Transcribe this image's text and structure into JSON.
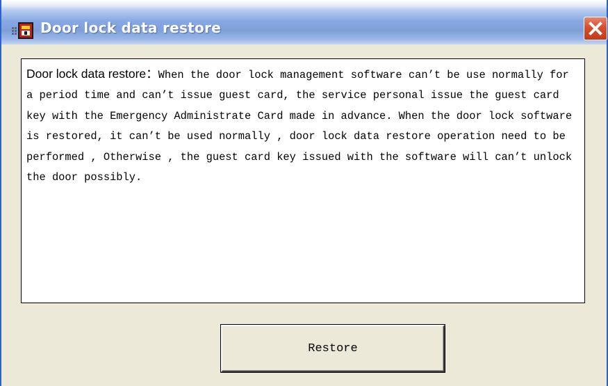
{
  "window": {
    "title": "Door lock data restore",
    "close_icon": "close-icon",
    "app_icon": "door-lock-app-icon",
    "accent_color": "#2d63c8",
    "close_color": "#d4502f"
  },
  "description": {
    "heading": "Door lock data restore：",
    "body": "When the door lock management software can’t be use normally for a period time and can’t issue guest card, the service personal issue the guest card key with the Emergency Administrate Card made in advance. When the door lock software is restored, it can’t be used normally , door lock data restore operation need to be performed , Otherwise , the guest card key issued with the software will can’t unlock the door possibly."
  },
  "actions": {
    "restore_label": "Restore"
  }
}
